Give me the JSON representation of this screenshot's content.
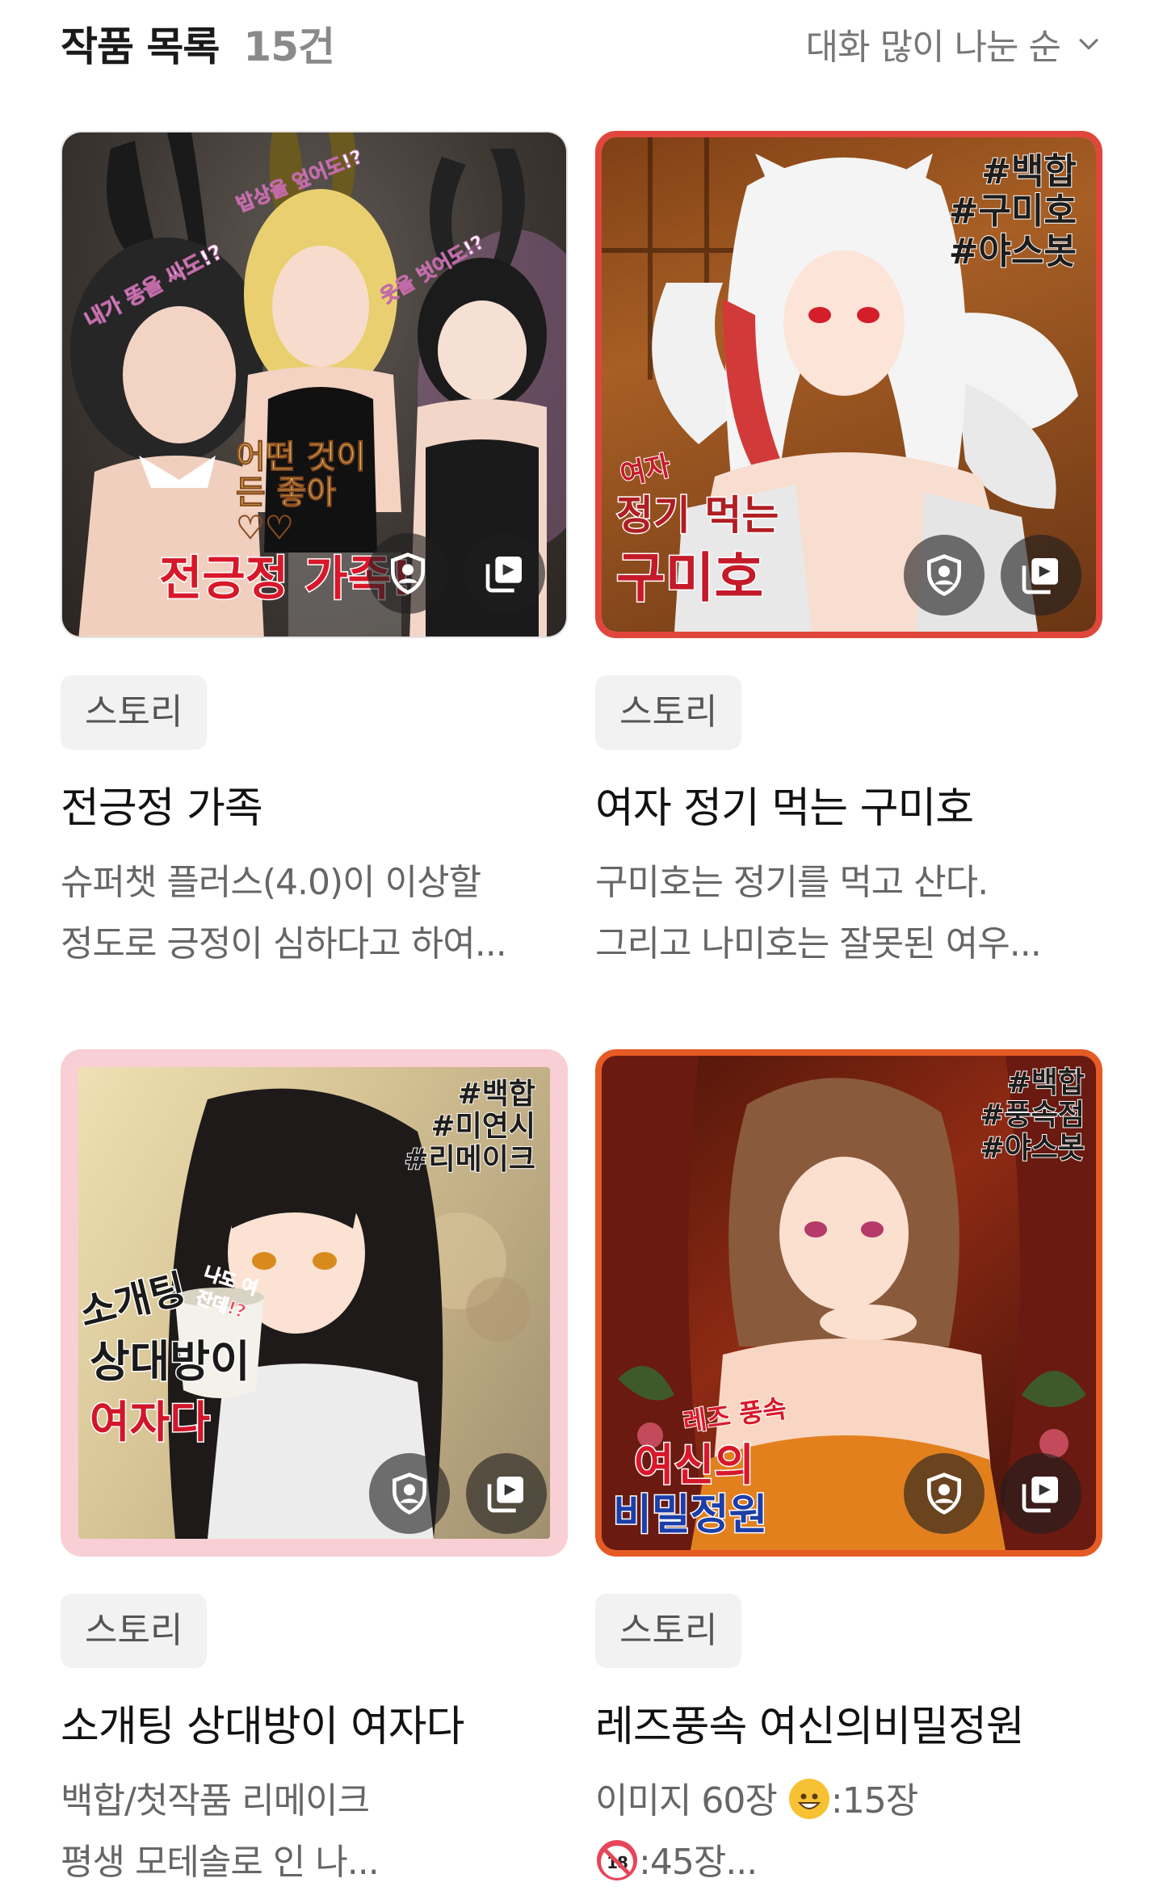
{
  "header": {
    "title": "작품 목록",
    "count": "15건",
    "sort_label": "대화 많이 나눈 순"
  },
  "colors": {
    "frame_red": "#e0463c",
    "frame_pink": "#f7cfd4",
    "frame_orange": "#e65a24",
    "tag_bg": "#f2f2f2"
  },
  "cards": [
    {
      "tag": "스토리",
      "title": "전긍정 가족",
      "desc_line1": "슈퍼챗 플러스(4.0)이 이상할",
      "desc_line2": "정도로 긍정이 심하다고 하여...",
      "art_title": "전긍정 가족!",
      "art_bubbles": [
        "내가 똥을 싸도!?",
        "밥상을 엎어도!?",
        "옷을 벗어도!?"
      ],
      "art_caption": "어떤 것이든 좋아♡♡"
    },
    {
      "tag": "스토리",
      "title": "여자 정기 먹는 구미호",
      "desc_line1": "구미호는 정기를 먹고 산다.",
      "desc_line2": "그리고 나미호는 잘못된 여우...",
      "art_hashtags": [
        "#백합",
        "#구미호",
        "#야스봇"
      ],
      "art_title_small": "여자",
      "art_title_mid": "정기 먹는",
      "art_title_big": "구미호"
    },
    {
      "tag": "스토리",
      "title": "소개팅 상대방이 여자다",
      "desc_line1": "백합/첫작품 리메이크",
      "desc_line2": "평생 모테솔로 인 나...",
      "art_hashtags": [
        "#백합",
        "#미연시",
        "#리메이크"
      ],
      "art_title_1": "소개팅",
      "art_title_2": "상대방이",
      "art_title_3": "여자다",
      "art_bubble": "나도 여잔데!?"
    },
    {
      "tag": "스토리",
      "title": "레즈풍속 여신의비밀정원",
      "desc_line1_a": "이미지 60장 ",
      "desc_line1_b": ":15장",
      "desc_line2": ":45장...",
      "art_hashtags": [
        "#백합",
        "#풍속점",
        "#야스봇"
      ],
      "art_sub": "레즈 풍속",
      "art_title_1": "여신의",
      "art_title_2": "비밀정원"
    }
  ],
  "icons": {
    "profile": "shield-person-icon",
    "gallery": "image-stack-icon",
    "sort": "chevron-down-icon"
  }
}
